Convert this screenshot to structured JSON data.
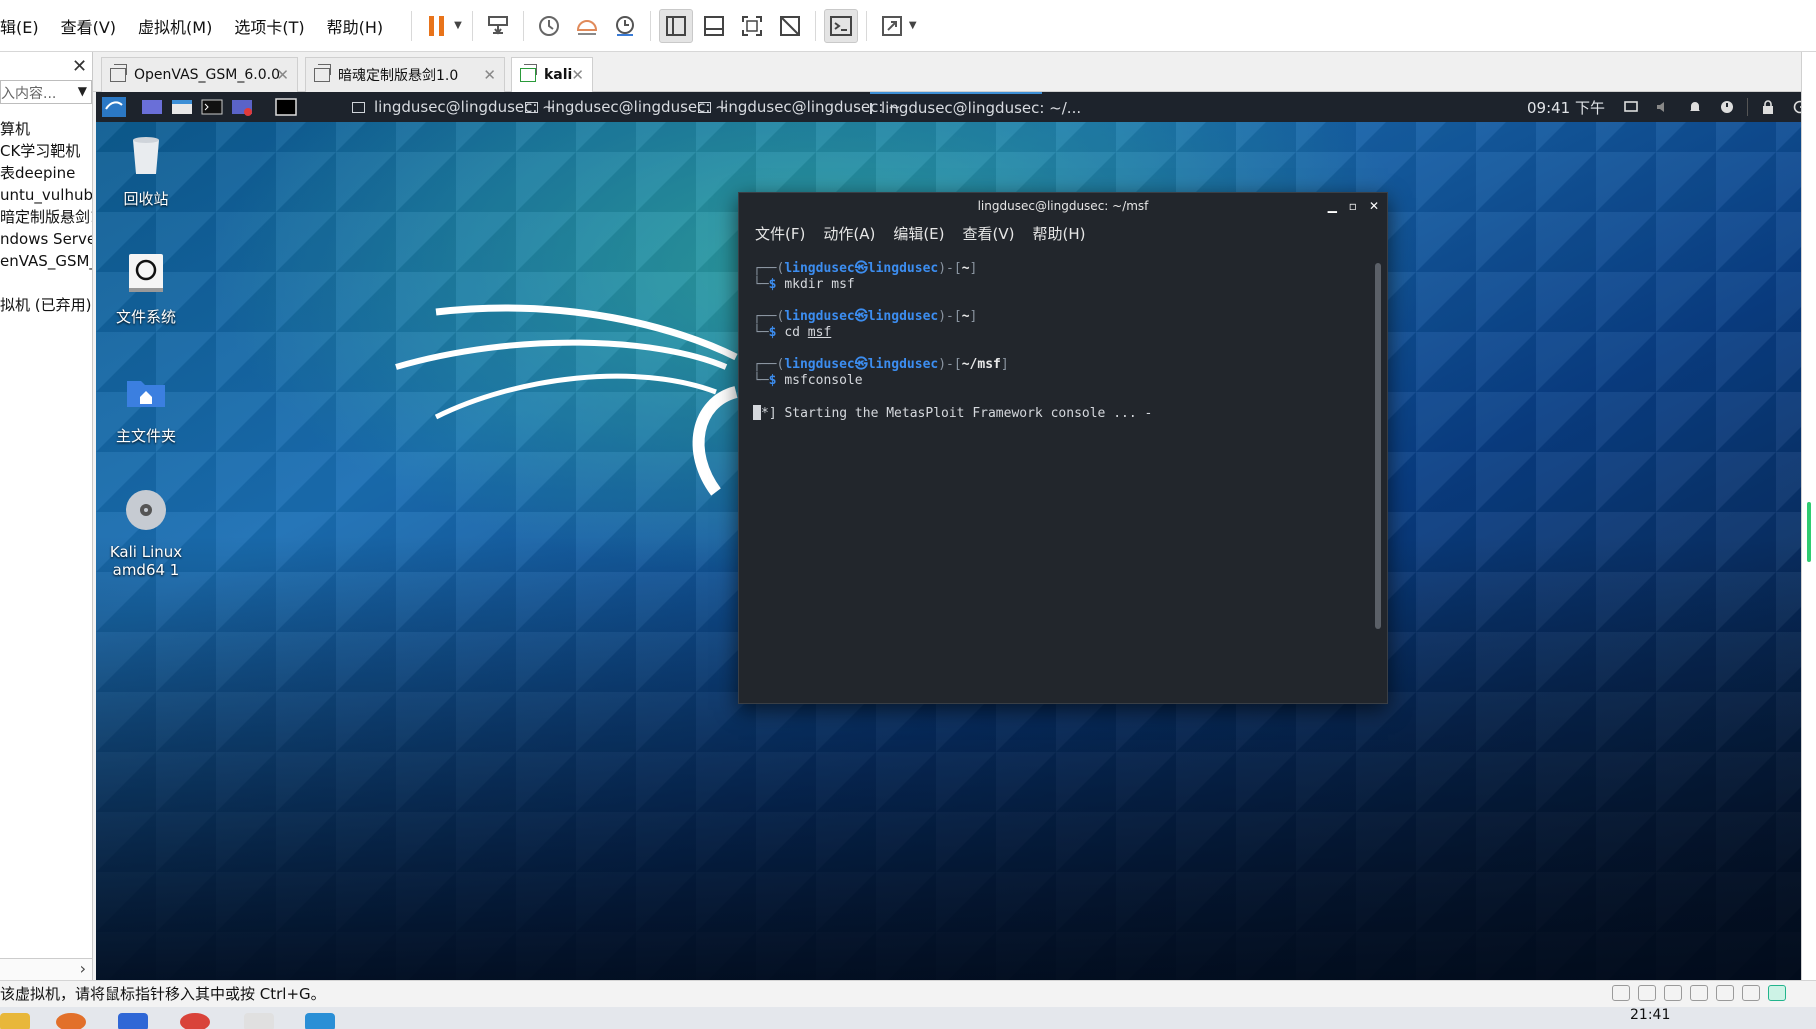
{
  "vmware": {
    "menus": [
      "辑(E)",
      "查看(V)",
      "虚拟机(M)",
      "选项卡(T)",
      "帮助(H)"
    ]
  },
  "library": {
    "search_placeholder": "入内容...",
    "items": [
      "算机",
      "CK学习靶机",
      "表deepine",
      "untu_vulhub",
      "暗定制版悬剑1",
      "ndows Server",
      "enVAS_GSM_",
      "",
      "拟机 (已弃用)"
    ]
  },
  "tabs": [
    {
      "label": "OpenVAS_GSM_6.0.0"
    },
    {
      "label": "暗魂定制版悬剑1.0"
    },
    {
      "label": "kali"
    }
  ],
  "kali_panel": {
    "tasks": [
      "lingdusec@lingdusec: ~",
      "lingdusec@lingdusec: ~",
      "lingdusec@lingdusec: ~",
      "lingdusec@lingdusec: ~/..."
    ],
    "clock": "09:41 下午"
  },
  "desktop_icons": [
    {
      "label": "回收站"
    },
    {
      "label": "文件系统"
    },
    {
      "label": "主文件夹"
    },
    {
      "label_line1": "Kali Linux",
      "label_line2": "amd64 1"
    }
  ],
  "terminal": {
    "title": "lingdusec@lingdusec: ~/msf",
    "menu": [
      "文件(F)",
      "动作(A)",
      "编辑(E)",
      "查看(V)",
      "帮助(H)"
    ],
    "user": "lingdusec",
    "host": "lingdusec",
    "blocks": [
      {
        "dir": "~",
        "cmd": "mkdir msf"
      },
      {
        "dir": "~",
        "cmd_prefix": "cd ",
        "cmd_arg": "msf"
      },
      {
        "dir": "~/msf",
        "cmd": "msfconsole"
      }
    ],
    "output": "] Starting the MetasPloit Framework console ... -"
  },
  "statusbar": {
    "text": "该虚拟机，请将鼠标指针移入其中或按 Ctrl+G。"
  },
  "host_taskbar": {
    "clock": "21:41"
  }
}
